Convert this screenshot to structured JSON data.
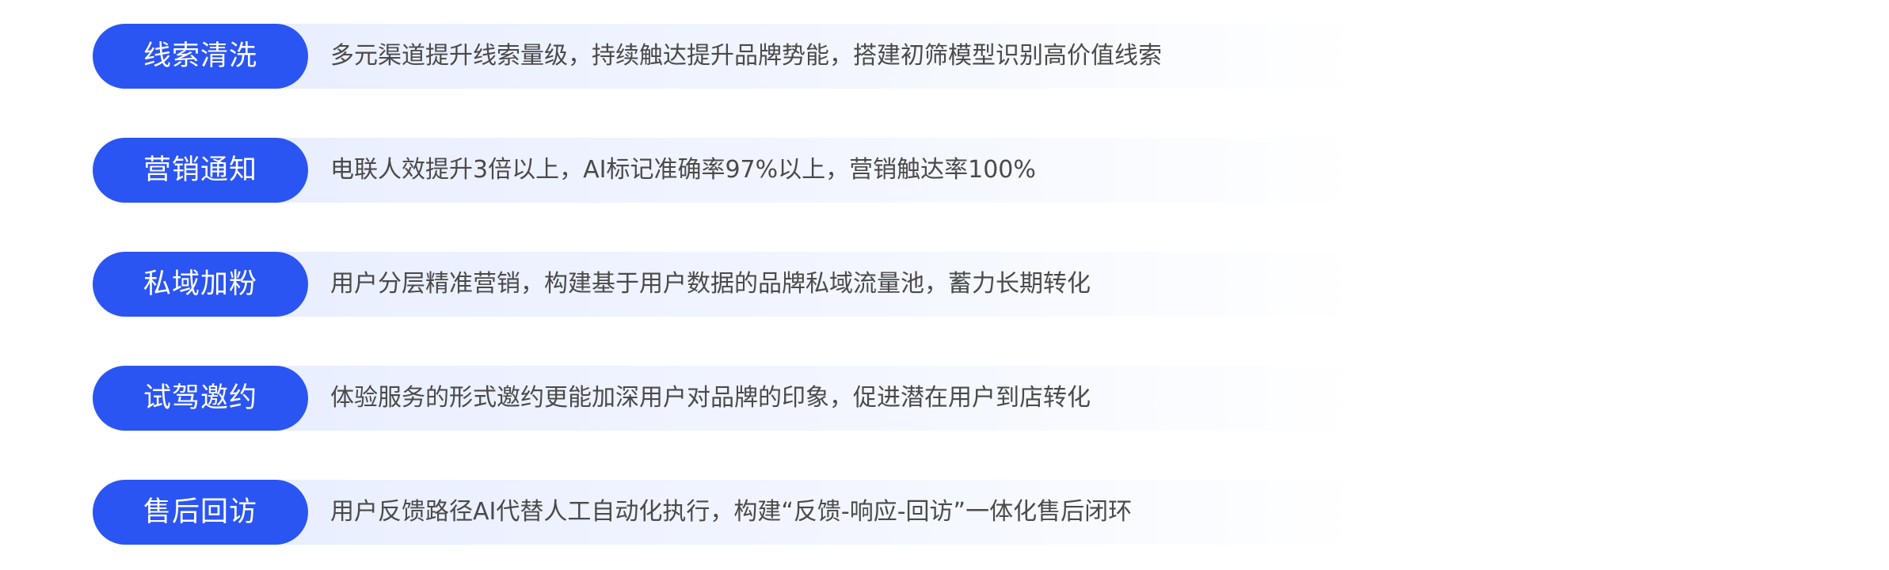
{
  "items": [
    {
      "label": "线索清洗",
      "text": "多元渠道提升线索量级，持续触达提升品牌势能，搭建初筛模型识别高价值线索"
    },
    {
      "label": "营销通知",
      "text": "电联人效提升3倍以上，AI标记准确率97%以上，营销触达率100%"
    },
    {
      "label": "私域加粉",
      "text": "用户分层精准营销，构建基于用户数据的品牌私域流量池，蓄力长期转化"
    },
    {
      "label": "试驾邀约",
      "text": "体验服务的形式邀约更能加深用户对品牌的印象，促进潜在用户到店转化"
    },
    {
      "label": "售后回访",
      "text": "用户反馈路径AI代替人工自动化执行，构建“反馈-响应-回访”一体化售后闭环"
    }
  ],
  "colors": {
    "pill": "#2b55f2",
    "band_start": "#e9eeff",
    "text": "#4a4a4a"
  }
}
